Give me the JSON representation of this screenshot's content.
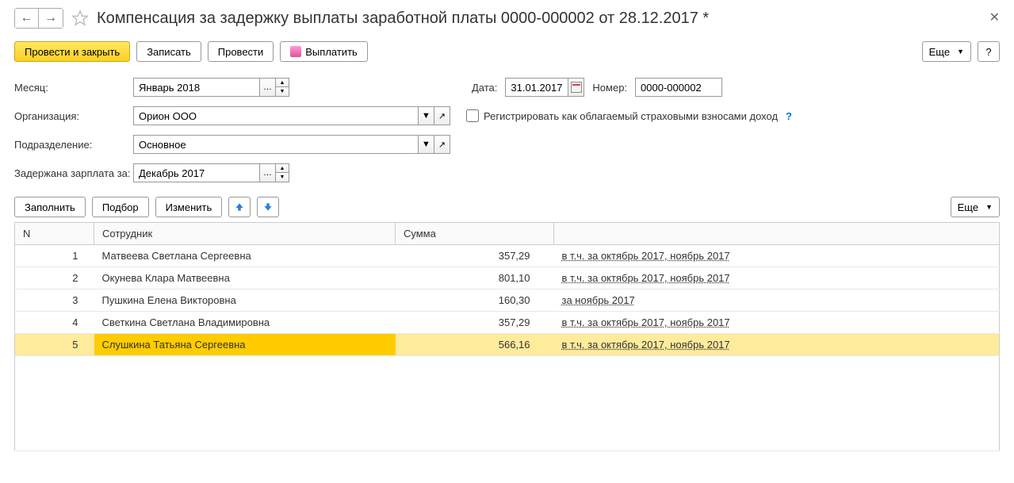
{
  "header": {
    "title": "Компенсация за задержку выплаты заработной платы 0000-000002 от 28.12.2017 *"
  },
  "toolbar": {
    "submit_close": "Провести и закрыть",
    "save": "Записать",
    "submit": "Провести",
    "pay": "Выплатить",
    "more": "Еще",
    "help": "?"
  },
  "form": {
    "month_label": "Месяц:",
    "month_value": "Январь 2018",
    "org_label": "Организация:",
    "org_value": "Орион ООО",
    "dept_label": "Подразделение:",
    "dept_value": "Основное",
    "delayed_label": "Задержана зарплата за:",
    "delayed_value": "Декабрь 2017",
    "date_label": "Дата:",
    "date_value": "31.01.2017",
    "number_label": "Номер:",
    "number_value": "0000-000002",
    "checkbox_label": "Регистрировать как облагаемый страховыми взносами доход"
  },
  "table_toolbar": {
    "fill": "Заполнить",
    "pick": "Подбор",
    "change": "Изменить",
    "more": "Еще"
  },
  "table": {
    "col_n": "N",
    "col_emp": "Сотрудник",
    "col_sum": "Сумма",
    "rows": [
      {
        "n": "1",
        "emp": "Матвеева Светлана Сергеевна",
        "sum": "357,29",
        "detail": "в т.ч. за октябрь 2017, ноябрь 2017"
      },
      {
        "n": "2",
        "emp": "Окунева Клара Матвеевна",
        "sum": "801,10",
        "detail": "в т.ч. за октябрь 2017, ноябрь 2017"
      },
      {
        "n": "3",
        "emp": "Пушкина Елена Викторовна",
        "sum": "160,30",
        "detail": "за ноябрь 2017"
      },
      {
        "n": "4",
        "emp": "Светкина Светлана Владимировна",
        "sum": "357,29",
        "detail": "в т.ч. за октябрь 2017, ноябрь 2017"
      },
      {
        "n": "5",
        "emp": "Слушкина Татьяна Сергеевна",
        "sum": "566,16",
        "detail": "в т.ч. за октябрь 2017, ноябрь 2017"
      }
    ]
  }
}
